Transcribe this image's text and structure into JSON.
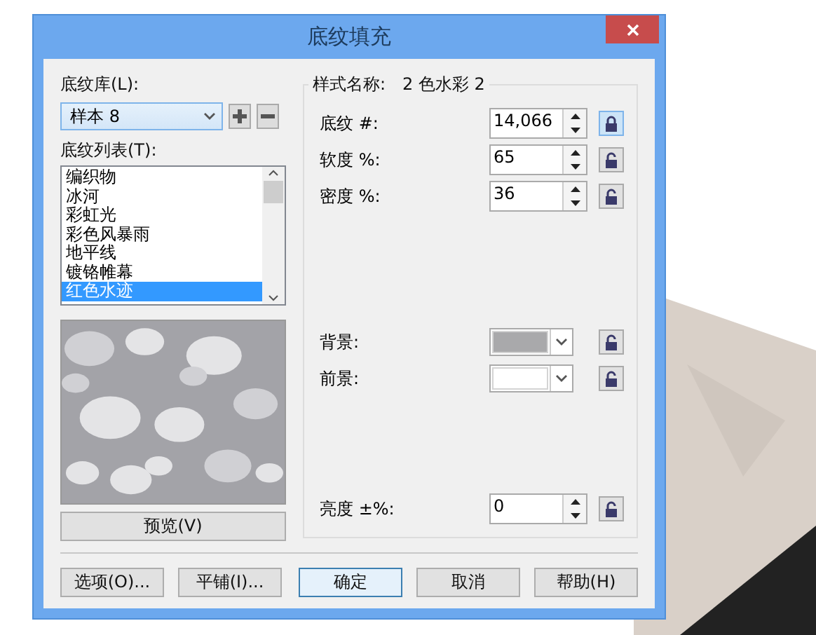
{
  "window": {
    "title": "底纹填充"
  },
  "library": {
    "label": "底纹库(L):",
    "value": "样本 8"
  },
  "texture_list": {
    "label": "底纹列表(T):",
    "items": [
      {
        "label": "编织物",
        "selected": false
      },
      {
        "label": "冰河",
        "selected": false
      },
      {
        "label": "彩虹光",
        "selected": false
      },
      {
        "label": "彩色风暴雨",
        "selected": false
      },
      {
        "label": "地平线",
        "selected": false
      },
      {
        "label": "镀铬帷幕",
        "selected": false
      },
      {
        "label": "红色水迹",
        "selected": true
      }
    ]
  },
  "preview_button": "预览(V)",
  "style_name": {
    "label": "样式名称:",
    "value": "2 色水彩 2"
  },
  "number_fields": [
    {
      "label": "底纹 #:",
      "value": "14,066",
      "locked": true
    },
    {
      "label": "软度 %:",
      "value": "65",
      "locked": false
    },
    {
      "label": "密度 %:",
      "value": "36",
      "locked": false
    }
  ],
  "color_fields": [
    {
      "label": "背景:",
      "color": "#a9a9ab",
      "locked": false
    },
    {
      "label": "前景:",
      "color": "#ffffff",
      "locked": false
    }
  ],
  "brightness": {
    "label": "亮度 ±%:",
    "value": "0",
    "locked": false
  },
  "buttons": [
    {
      "label": "选项(O)...",
      "default": false
    },
    {
      "label": "平铺(I)...",
      "default": false
    },
    {
      "label": "确定",
      "default": true
    },
    {
      "label": "取消",
      "default": false
    },
    {
      "label": "帮助(H)",
      "default": false
    }
  ]
}
